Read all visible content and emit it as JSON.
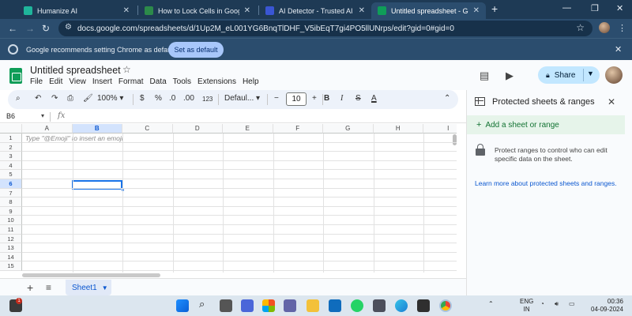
{
  "browser": {
    "tabs": [
      {
        "title": "Humanize AI",
        "favicon_color": "#1fb59b"
      },
      {
        "title": "How to Lock Cells in Google Sh",
        "favicon_color": "#2c8a4a"
      },
      {
        "title": "AI Detector - Trusted AI Checke",
        "favicon_color": "#3a56d4"
      },
      {
        "title": "Untitled spreadsheet - Google",
        "favicon_color": "#0f9d58"
      }
    ],
    "url": "docs.google.com/spreadsheets/d/1Up2M_eL001YG6BnqTlDHF_V5ibEqT7gi4PO5llUNrps/edit?gid=0#gid=0",
    "infobar": {
      "message": "Google recommends setting Chrome as default",
      "button": "Set as default"
    }
  },
  "sheets": {
    "title": "Untitled spreadsheet",
    "menu": [
      "File",
      "Edit",
      "View",
      "Insert",
      "Format",
      "Data",
      "Tools",
      "Extensions",
      "Help"
    ],
    "share_label": "Share",
    "toolbar": {
      "zoom": "100%",
      "currency": "$",
      "percent": "%",
      "dec_decrease": ".0",
      "dec_increase": ".00",
      "number_format": "123",
      "font": "Defaul...",
      "font_size": "10",
      "bold": "B",
      "italic": "I",
      "text_color": "A"
    },
    "name_box": "B6",
    "fx_label": "fx",
    "columns": [
      "A",
      "B",
      "C",
      "D",
      "E",
      "F",
      "G",
      "H",
      "I"
    ],
    "rows": [
      "1",
      "2",
      "3",
      "4",
      "5",
      "6",
      "7",
      "8",
      "9",
      "10",
      "11",
      "12",
      "13",
      "14",
      "15"
    ],
    "selected_cell": {
      "column": "B",
      "row": "6"
    },
    "cell_hint": "Type \"@Emoji\" to insert an emoji",
    "sheet_tab": "Sheet1",
    "selection_color": "#1a73e8"
  },
  "panel": {
    "title": "Protected sheets & ranges",
    "add_label": "Add a sheet or range",
    "description": "Protect ranges to control who can edit specific data on the sheet.",
    "link": "Learn more about protected sheets and ranges."
  },
  "taskbar": {
    "badge": "1",
    "lang_top": "ENG",
    "lang_bottom": "IN",
    "time": "00:36",
    "date": "04-09-2024"
  }
}
